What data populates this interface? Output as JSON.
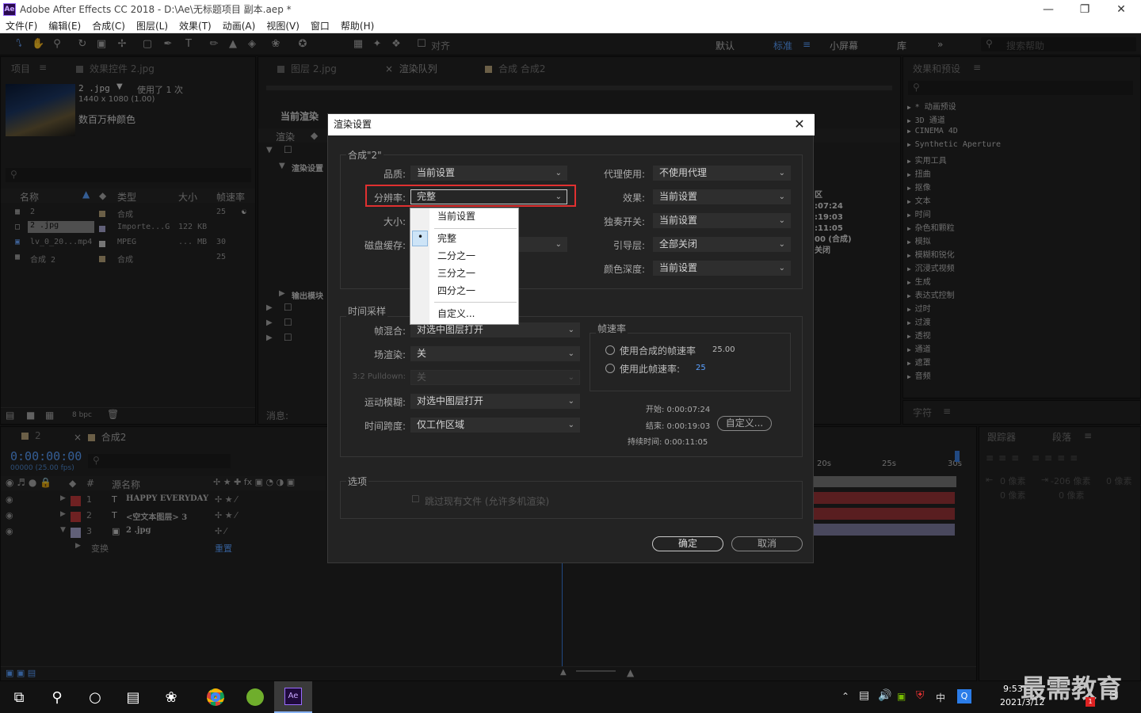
{
  "app": {
    "title": "Adobe After Effects CC 2018 - D:\\Ae\\无标题项目 副本.aep *",
    "logo": "Ae"
  },
  "menu": [
    "文件(F)",
    "编辑(E)",
    "合成(C)",
    "图层(L)",
    "效果(T)",
    "动画(A)",
    "视图(V)",
    "窗口",
    "帮助(H)"
  ],
  "toolbar": {
    "align_label": "对齐",
    "workspaces": [
      "默认",
      "标准",
      "小屏幕",
      "库"
    ],
    "search_placeholder": "搜索帮助"
  },
  "project": {
    "tabs": [
      "项目",
      "效果控件 2.jpg"
    ],
    "thumb_name": "2 .jpg",
    "used": "使用了 1 次",
    "dims": "1440 x 1080 (1.00)",
    "colors": "数百万种颜色",
    "columns": [
      "名称",
      "类型",
      "大小",
      "帧速率"
    ],
    "rows": [
      {
        "name": "2",
        "type": "合成",
        "size": "",
        "fps": "25"
      },
      {
        "name": "2 .jpg",
        "type": "Importe...G",
        "size": "122 KB",
        "fps": ""
      },
      {
        "name": "lv_0_20...mp4",
        "type": "MPEG",
        "size": "... MB",
        "fps": "30"
      },
      {
        "name": "合成 2",
        "type": "合成",
        "size": "",
        "fps": "25"
      }
    ],
    "bpc": "8 bpc"
  },
  "center": {
    "tabs": [
      "图层 2.jpg",
      "渲染队列",
      "合成 合成2"
    ],
    "current_render": "当前渲染",
    "render_col": "渲染",
    "render_settings": "渲染设置",
    "output_module": "输出模块",
    "messages": "消息:",
    "info_lines": [
      "区",
      ":07:24",
      ":19:03",
      ":11:05",
      "00 (合成)",
      "关闭"
    ]
  },
  "effects": {
    "title": "效果和预设",
    "items": [
      "* 动画预设",
      "3D 通道",
      "CINEMA 4D",
      "Synthetic Aperture",
      "实用工具",
      "扭曲",
      "抠像",
      "文本",
      "时间",
      "杂色和颗粒",
      "模拟",
      "模糊和锐化",
      "沉浸式视频",
      "生成",
      "表达式控制",
      "过时",
      "过渡",
      "透视",
      "通道",
      "遮罩",
      "音频"
    ],
    "char_tab": "字符",
    "tracker_tab": "跟踪器",
    "para_tab": "段落",
    "para_vals": [
      "0 像素",
      "-206 像素",
      "0 像素",
      "0 像素",
      "0 像素"
    ]
  },
  "timeline": {
    "tabs": [
      "2",
      "合成2"
    ],
    "timecode": "0:00:00:00",
    "fps_info": "00000 (25.00 fps)",
    "col_source": "源名称",
    "layers": [
      {
        "num": "1",
        "name": "HAPPY EVERYDAY",
        "color": "#c0393c"
      },
      {
        "num": "2",
        "name": "<空文本图层> 3",
        "color": "#c0393c"
      },
      {
        "num": "3",
        "name": "2 .jpg",
        "color": "#a8a6cf"
      }
    ],
    "transform": "变换",
    "reset": "重置",
    "ruler": [
      "20s",
      "25s",
      "30s"
    ]
  },
  "dialog": {
    "title": "渲染设置",
    "comp_group": "合成\"2\"",
    "quality_label": "品质:",
    "quality_value": "当前设置",
    "resolution_label": "分辨率:",
    "resolution_value": "完整",
    "size_label": "大小:",
    "disk_cache_label": "磁盘缓存:",
    "proxy_label": "代理使用:",
    "proxy_value": "不使用代理",
    "effects_label": "效果:",
    "effects_value": "当前设置",
    "solo_label": "独奏开关:",
    "solo_value": "当前设置",
    "guide_label": "引导层:",
    "guide_value": "全部关闭",
    "depth_label": "颜色深度:",
    "depth_value": "当前设置",
    "time_group": "时间采样",
    "frame_blend_label": "帧混合:",
    "frame_blend_value": "对选中图层打开",
    "field_label": "场渲染:",
    "field_value": "关",
    "pulldown_label": "3:2 Pulldown:",
    "pulldown_value": "关",
    "motion_blur_label": "运动模糊:",
    "motion_blur_value": "对选中图层打开",
    "time_span_label": "时间跨度:",
    "time_span_value": "仅工作区域",
    "fps_group": "帧速率",
    "fps_opt1": "使用合成的帧速率",
    "fps_opt1_val": "25.00",
    "fps_opt2": "使用此帧速率:",
    "fps_opt2_val": "25",
    "start": "开始: 0:00:07:24",
    "end": "结束: 0:00:19:03",
    "duration": "持续时间: 0:00:11:05",
    "custom_btn": "自定义...",
    "options_group": "选项",
    "skip_label": "跳过现有文件 (允许多机渲染)",
    "ok": "确定",
    "cancel": "取消",
    "res_options": [
      "当前设置",
      "完整",
      "二分之一",
      "三分之一",
      "四分之一",
      "自定义..."
    ],
    "highlight_color": "#e03030"
  },
  "taskbar": {
    "time": "9:53",
    "date": "2021/3/12",
    "ime": "中",
    "badge": "1",
    "watermark": "最需教育"
  }
}
